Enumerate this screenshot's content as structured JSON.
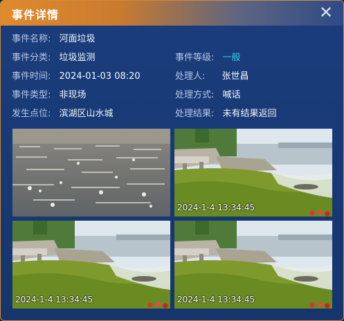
{
  "dialog": {
    "title": "事件详情",
    "close_icon": "close-icon"
  },
  "fields": {
    "name_label": "事件名称:",
    "name_value": "河面垃圾",
    "category_label": "事件分类:",
    "category_value": "垃圾监测",
    "level_label": "事件等级:",
    "level_value": "一般",
    "time_label": "事件时间:",
    "time_value": "2024-01-03 08:20",
    "handler_label": "处理人:",
    "handler_value": "张世昌",
    "type_label": "事件类型:",
    "type_value": "非现场",
    "method_label": "处理方式:",
    "method_value": "喊话",
    "location_label": "发生点位:",
    "location_value": "滨湖区山水城",
    "result_label": "处理结果:",
    "result_value": "未有结果返回"
  },
  "photos": [
    {
      "timestamp": ""
    },
    {
      "timestamp": "2024-1-4   13:34:45"
    },
    {
      "timestamp": "2024-1-4   13:34:45"
    },
    {
      "timestamp": "2024-1-4   13:34:45"
    }
  ],
  "colors": {
    "header_orange": "#e08a2e",
    "panel_blue": "#1b3d7c",
    "level_cyan": "#28d7e6"
  }
}
